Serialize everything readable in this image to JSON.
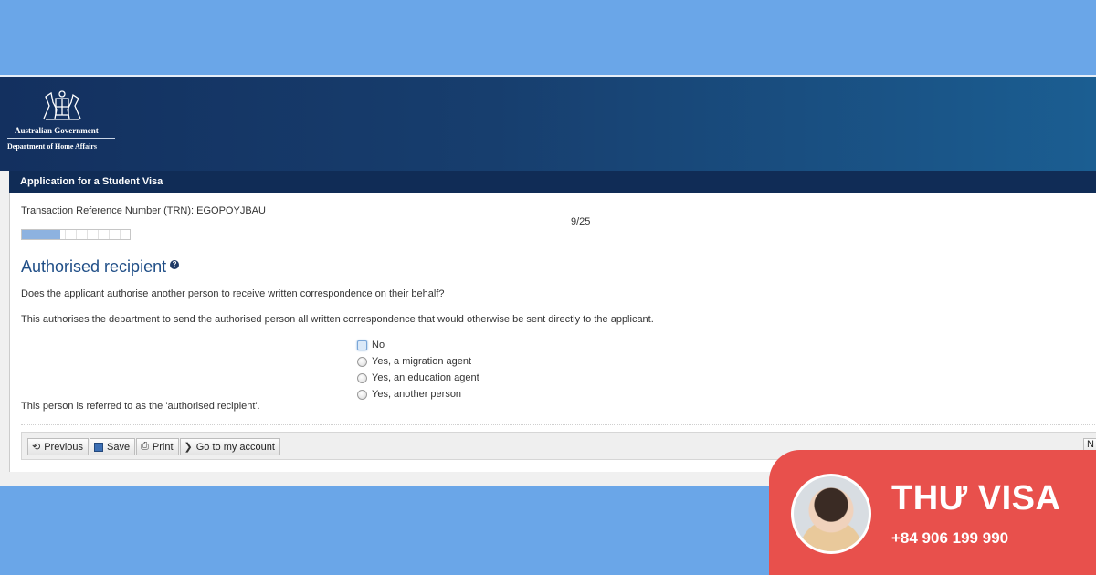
{
  "header": {
    "gov_line1": "Australian Government",
    "gov_line2": "Department of Home Affairs"
  },
  "title_bar": "Application for a Student Visa",
  "form": {
    "trn": "Transaction Reference Number (TRN): EGOPOYJBAU",
    "page_count": "9/25",
    "progress": {
      "current": 9,
      "total": 25
    },
    "heading": "Authorised recipient",
    "help_glyph": "?",
    "question": "Does the applicant authorise another person to receive written correspondence on their behalf?",
    "explanation": "This authorises the department to send the authorised person all written correspondence that would otherwise be sent directly to the applicant.",
    "options": [
      {
        "label": "No",
        "selected": true
      },
      {
        "label": "Yes, a migration agent",
        "selected": false
      },
      {
        "label": "Yes, an education agent",
        "selected": false
      },
      {
        "label": "Yes, another person",
        "selected": false
      }
    ],
    "note": "This person is referred to as the 'authorised recipient'."
  },
  "toolbar": {
    "previous": "Previous",
    "save": "Save",
    "print": "Print",
    "account": "Go to my account",
    "next_stub": "N"
  },
  "badge": {
    "brand": "THƯ VISA",
    "phone": "+84 906 199 990",
    "color": "#e8504c"
  },
  "colors": {
    "background": "#6aa6e8",
    "header_dark": "#13305f",
    "heading_blue": "#1f4e87"
  }
}
